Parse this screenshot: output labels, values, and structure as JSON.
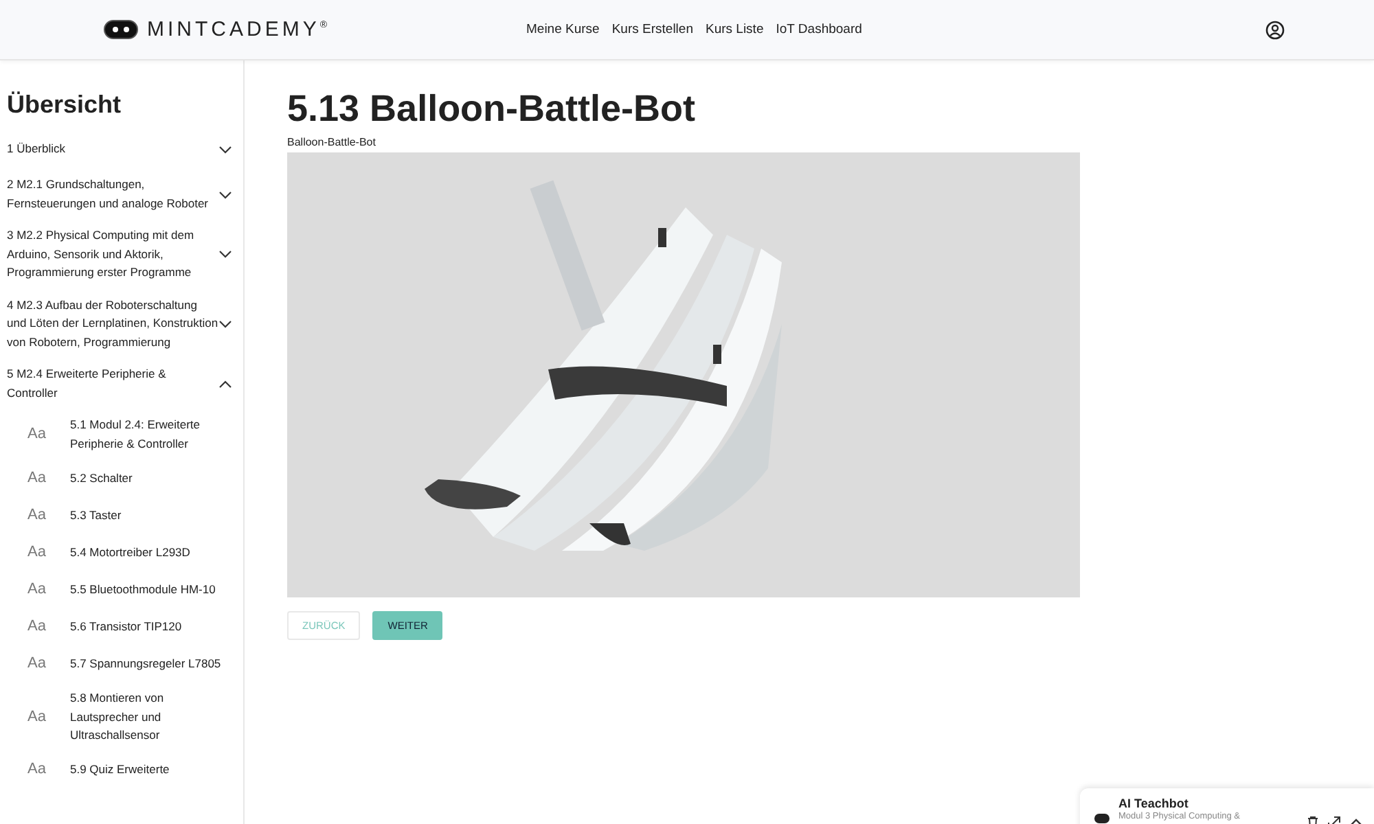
{
  "header": {
    "logo": "MINTCADEMY",
    "logo_mark": "®",
    "nav": [
      "Meine Kurse",
      "Kurs Erstellen",
      "Kurs Liste",
      "IoT Dashboard"
    ]
  },
  "sidebar": {
    "title": "Übersicht",
    "sections": [
      {
        "label": "1 Überblick",
        "expanded": false
      },
      {
        "label": "2 M2.1 Grundschaltungen, Fernsteuerungen und analoge Roboter",
        "expanded": false
      },
      {
        "label": "3 M2.2 Physical Computing mit dem Arduino, Sensorik und Aktorik, Programmierung erster Programme",
        "expanded": false
      },
      {
        "label": "4 M2.3 Aufbau der Roboterschaltung und Löten der Lernplatinen, Konstruktion von Robotern, Programmierung",
        "expanded": false
      },
      {
        "label": "5 M2.4 Erweiterte Peripherie & Controller",
        "expanded": true,
        "children": [
          {
            "icon": "Aa",
            "label": "5.1 Modul 2.4: Erweiterte Peripherie & Controller"
          },
          {
            "icon": "Aa",
            "label": "5.2 Schalter"
          },
          {
            "icon": "Aa",
            "label": "5.3 Taster"
          },
          {
            "icon": "Aa",
            "label": "5.4 Motortreiber L293D"
          },
          {
            "icon": "Aa",
            "label": "5.5 Bluetoothmodule HM-10"
          },
          {
            "icon": "Aa",
            "label": "5.6 Transistor TIP120"
          },
          {
            "icon": "Aa",
            "label": "5.7 Spannungsregeler L7805"
          },
          {
            "icon": "Aa",
            "label": "5.8 Montieren von Lautsprecher und Ultraschallsensor"
          },
          {
            "icon": "Aa",
            "label": "5.9 Quiz Erweiterte"
          }
        ]
      }
    ]
  },
  "main": {
    "title": "5.13 Balloon-Battle-Bot",
    "caption": "Balloon-Battle-Bot",
    "buttons": [
      {
        "label": "ZURÜCK",
        "kind": "outline"
      },
      {
        "label": "WEITER",
        "kind": "filled"
      }
    ]
  },
  "chat": {
    "title": "AI Teachbot",
    "subtitle": "Modul 3 Physical Computing &"
  }
}
